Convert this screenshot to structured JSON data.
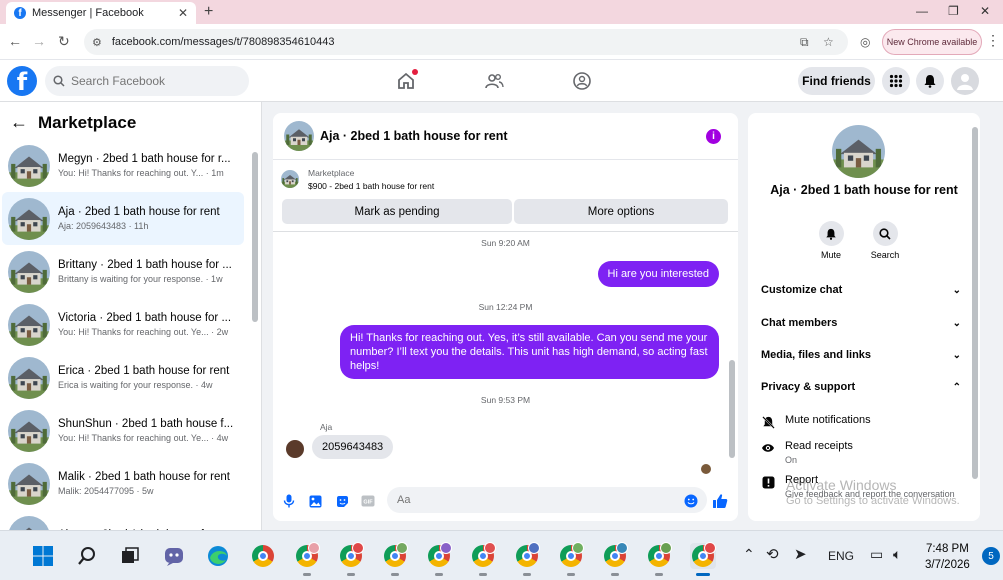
{
  "browser": {
    "tab_title": "Messenger | Facebook",
    "url": "facebook.com/messages/t/780898354610443",
    "new_chrome_label": "New Chrome available"
  },
  "header": {
    "logo": "f",
    "search_placeholder": "Search Facebook",
    "find_friends": "Find friends"
  },
  "left_panel": {
    "title": "Marketplace",
    "conversations": [
      {
        "name": "Megyn · 2bed 1 bath house for r...",
        "preview": "You: Hi! Thanks for reaching out. Y...  · 1m",
        "active": false
      },
      {
        "name": "Aja · 2bed 1 bath house for rent",
        "preview": "Aja: 2059643483 · 11h",
        "active": true
      },
      {
        "name": "Brittany · 2bed 1 bath house for ...",
        "preview": "Brittany is waiting for your response. · 1w",
        "active": false
      },
      {
        "name": "Victoria · 2bed 1 bath house for ...",
        "preview": "You: Hi! Thanks for reaching out. Ye... · 2w",
        "active": false
      },
      {
        "name": "Erica · 2bed 1 bath house for rent",
        "preview": "Erica is waiting for your response. · 4w",
        "active": false
      },
      {
        "name": "ShunShun · 2bed 1 bath house f...",
        "preview": "You: Hi! Thanks for reaching out. Ye... · 4w",
        "active": false
      },
      {
        "name": "Malik · 2bed 1 bath house for rent",
        "preview": "Malik: 2054477095 · 5w",
        "active": false
      },
      {
        "name": "Alyssa · 2bed 1 bath house for re...",
        "preview": "",
        "active": false
      }
    ]
  },
  "chat": {
    "title": "Aja · 2bed 1 bath house for rent",
    "marketplace_label": "Marketplace",
    "listing": "$900 - 2bed 1 bath house for rent",
    "mark_pending": "Mark as pending",
    "more_options": "More options",
    "messages": {
      "ts1": "Sun 9:20 AM",
      "out1": "Hi are you interested",
      "ts2": "Sun 12:24 PM",
      "out2": "Hi! Thanks for reaching out. Yes, it’s still available. Can you send me your number? I’ll text you the details. This unit has high demand, so acting fast helps!",
      "ts3": "Sun 9:53 PM",
      "sender": "Aja",
      "in1": "2059643483"
    },
    "composer_placeholder": "Aa"
  },
  "right_panel": {
    "title": "Aja · 2bed 1 bath house for rent",
    "mute": "Mute",
    "search": "Search",
    "sections": {
      "customize": "Customize chat",
      "members": "Chat members",
      "media": "Media, files and links",
      "privacy": "Privacy & support"
    },
    "mute_notifications": "Mute notifications",
    "read_receipts": "Read receipts",
    "read_receipts_state": "On",
    "report": "Report",
    "report_desc": "Give feedback and report the conversation"
  },
  "watermark": {
    "title": "Activate Windows",
    "subtitle": "Go to Settings to activate Windows."
  },
  "taskbar": {
    "language": "ENG",
    "time": "7:48 PM",
    "date": "3/7/2026",
    "notifications": "5"
  },
  "colors": {
    "fb_blue": "#1877f2",
    "bubble_purple": "#7e22f3",
    "info_purple": "#a100e0"
  }
}
